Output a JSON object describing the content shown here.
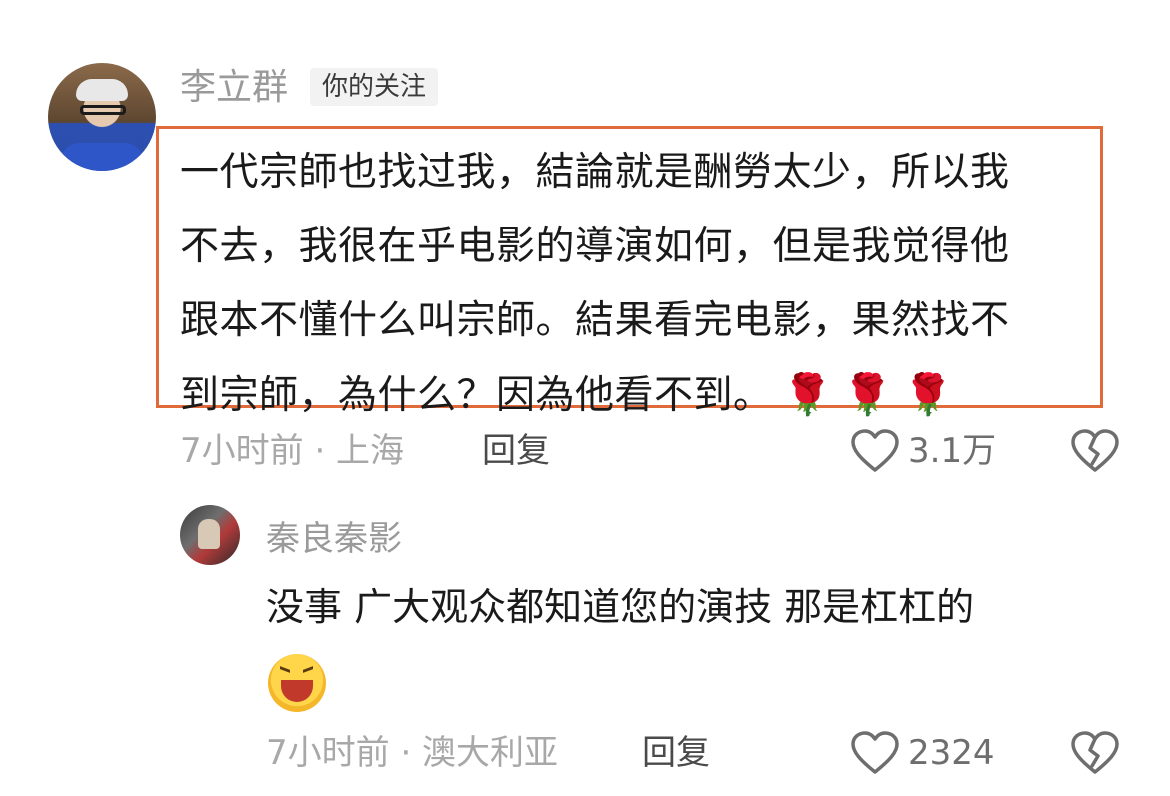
{
  "comment": {
    "author": "李立群",
    "badge": "你的关注",
    "lines": [
      "一代宗師也找过我，結論就是酬勞太少，所以我",
      "不去，我很在乎电影的導演如何，但是我觉得他",
      "跟本不懂什么叫宗師。結果看完电影，果然找不",
      "到宗師，為什么？因為他看不到。"
    ],
    "emojis": [
      "🌹",
      "🌹",
      "🌹"
    ],
    "meta": "7小时前 · 上海",
    "reply_label": "回复",
    "like_count": "3.1万"
  },
  "reply": {
    "author": "秦良秦影",
    "text": "没事 广大观众都知道您的演技 那是杠杠的",
    "emoji": "laughing-face",
    "meta": "7小时前 · 澳大利亚",
    "reply_label": "回复",
    "like_count": "2324"
  },
  "colors": {
    "highlight_border": "#e06a3a",
    "muted_text": "#a8a8a8"
  }
}
